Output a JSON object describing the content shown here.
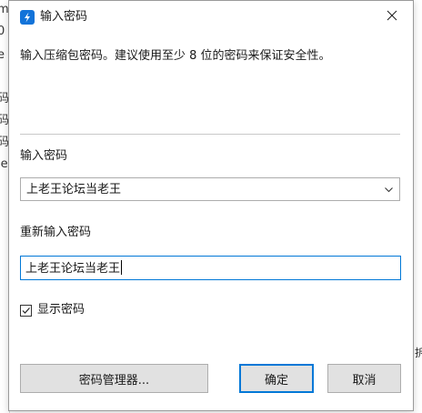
{
  "background_window": {
    "left_glyphs": [
      "m",
      "0",
      "e",
      "i",
      "码",
      "码",
      "码",
      "le"
    ],
    "right_text": "拆"
  },
  "dialog": {
    "title": "输入密码",
    "description": "输入压缩包密码。建议使用至少 8 位的密码来保证安全性。",
    "password_label": "输入密码",
    "password_value": "上老王论坛当老王",
    "repeat_label": "重新输入密码",
    "repeat_value": "上老王论坛当老王",
    "show_password_label": "显示密码",
    "show_password_checked": true,
    "buttons": {
      "manager": "密码管理器...",
      "ok": "确定",
      "cancel": "取消"
    }
  },
  "colors": {
    "accent": "#0078d7",
    "button_face": "#e1e1e1",
    "border": "#adadad"
  },
  "icons": {
    "app": "bandizip-icon",
    "close": "close-icon",
    "dropdown": "chevron-down-icon",
    "check": "checkmark-icon"
  }
}
